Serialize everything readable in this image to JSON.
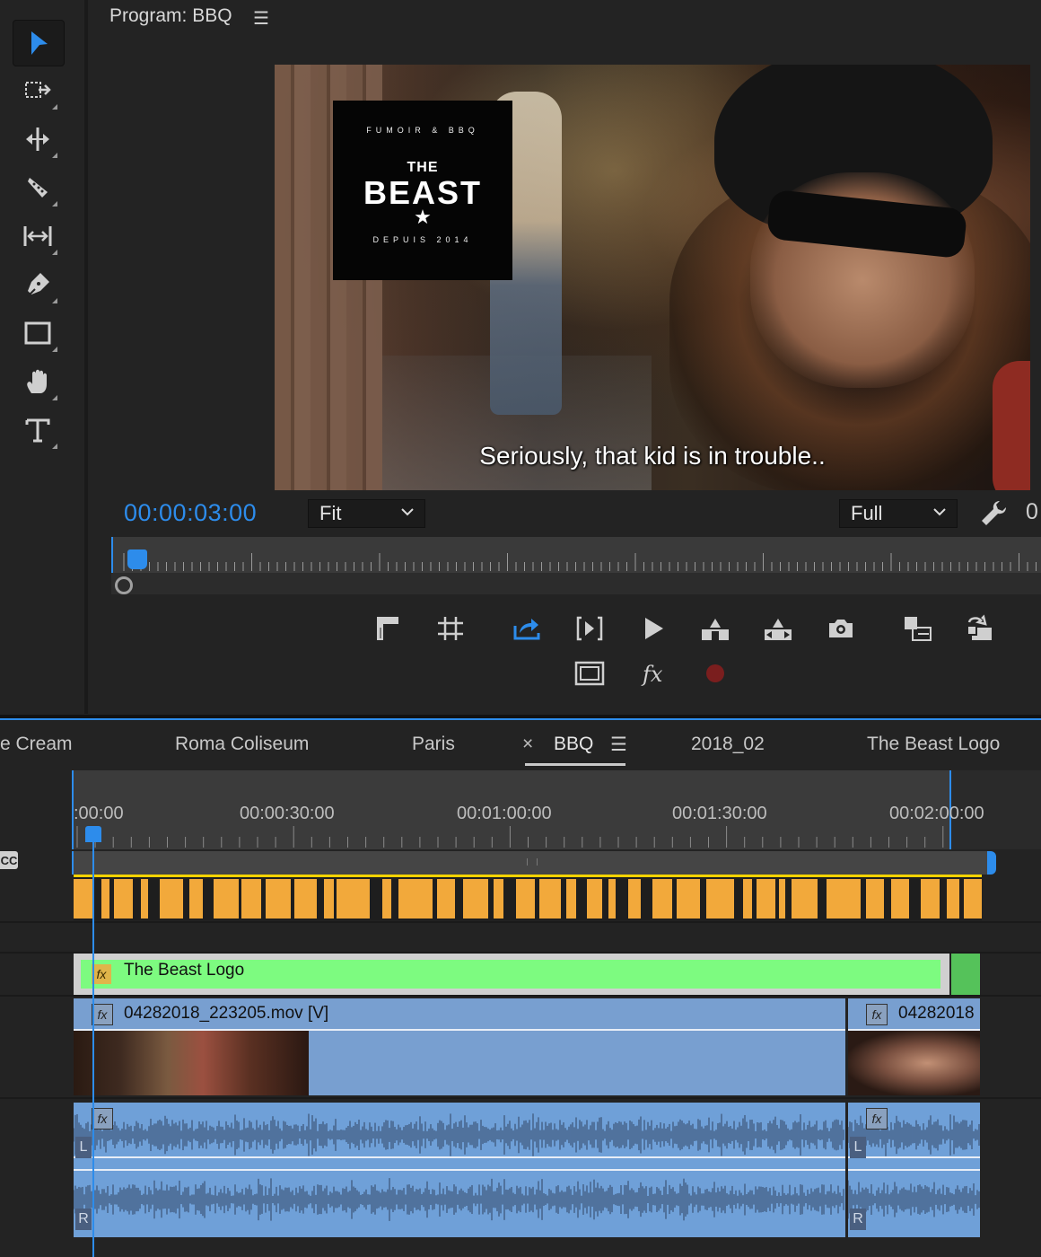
{
  "program": {
    "title": "Program: BBQ",
    "menu_icon": "hamburger-icon",
    "timecode": "00:00:03:00",
    "fit_label": "Fit",
    "quality_label": "Full",
    "overflow_text": "0",
    "subtitle": "Seriously, that kid is in trouble..",
    "logo": {
      "top_arc": "FUMOIR & BBQ",
      "line1": "THE",
      "line2": "BEAST",
      "star": "★",
      "bottom_arc": "DEPUIS 2014"
    }
  },
  "tools": [
    {
      "name": "selection-tool",
      "icon": "arrow-icon",
      "active": true
    },
    {
      "name": "track-select-tool",
      "icon": "track-select-icon"
    },
    {
      "name": "ripple-edit-tool",
      "icon": "ripple-edit-icon"
    },
    {
      "name": "razor-tool",
      "icon": "razor-icon"
    },
    {
      "name": "slip-tool",
      "icon": "slip-icon"
    },
    {
      "name": "pen-tool",
      "icon": "pen-icon"
    },
    {
      "name": "rectangle-tool",
      "icon": "rectangle-icon"
    },
    {
      "name": "hand-tool",
      "icon": "hand-icon"
    },
    {
      "name": "type-tool",
      "icon": "type-icon"
    }
  ],
  "tabs": [
    {
      "label": "e Cream"
    },
    {
      "label": "Roma Coliseum"
    },
    {
      "label": "Paris"
    },
    {
      "label": "BBQ",
      "active": true,
      "close": "×",
      "menu": "☰"
    },
    {
      "label": "2018_02"
    },
    {
      "label": "The Beast Logo"
    }
  ],
  "timeline": {
    "times": [
      ":00:00",
      "00:00:30:00",
      "00:01:00:00",
      "00:01:30:00",
      "00:02:00:00"
    ],
    "cc_badge": "CC",
    "clips": {
      "logo": {
        "label": "The Beast Logo",
        "fx": "fx"
      },
      "video1": {
        "label": "04282018_223205.mov [V]",
        "fx": "fx"
      },
      "video2": {
        "label": "04282018",
        "fx": "fx"
      },
      "audio1": {
        "fx": "fx",
        "left": "L",
        "right": "R"
      },
      "audio2": {
        "fx": "fx",
        "left": "L",
        "right": "R"
      }
    }
  },
  "colors": {
    "accent": "#2d8ceb",
    "marker": "#f2a93b",
    "logo_clip": "#7dfb80",
    "video_clip": "#789fd0",
    "audio_clip": "#6fa0d8",
    "record": "#7a1e1e"
  }
}
